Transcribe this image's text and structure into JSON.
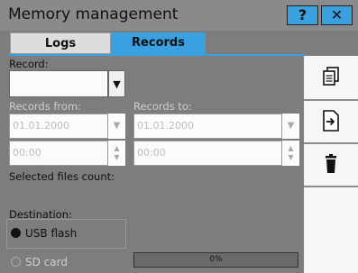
{
  "window": {
    "title": "Memory management"
  },
  "titlebar": {
    "help_label": "?",
    "close_label": "✕"
  },
  "tabs": [
    {
      "label": "Logs",
      "active": false
    },
    {
      "label": "Records",
      "active": true
    }
  ],
  "form": {
    "record_label": "Record:",
    "record_value": "",
    "records_from_label": "Records from:",
    "records_to_label": "Records to:",
    "from_date": "01.01.2000",
    "from_time": "00:00",
    "to_date": "01.01.2000",
    "to_time": "00:00",
    "selected_files_label": "Selected files count:",
    "destination_label": "Destination:",
    "dest_options": [
      {
        "label": "USB flash",
        "selected": true
      },
      {
        "label": "SD card",
        "selected": false
      }
    ]
  },
  "progress": {
    "label": "0%",
    "value": 0
  },
  "toolbar": {
    "icons": [
      "copy-icon",
      "export-icon",
      "delete-icon"
    ]
  },
  "colors": {
    "accent": "#3aa0e0",
    "background": "#7d7d7d"
  }
}
